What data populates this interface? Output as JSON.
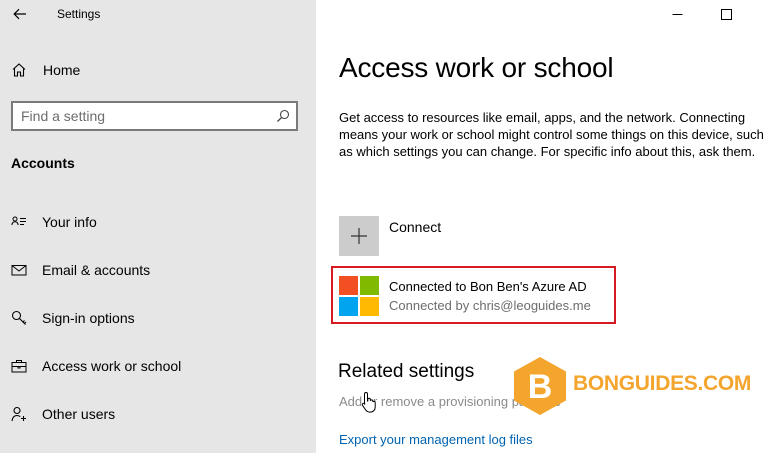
{
  "window": {
    "title": "Settings",
    "back_icon": "arrow-left-icon",
    "minimize_icon": "minimize-icon",
    "maximize_icon": "maximize-icon"
  },
  "sidebar": {
    "home_label": "Home",
    "search_placeholder": "Find a setting",
    "section_title": "Accounts",
    "items": [
      {
        "label": "Your info",
        "icon": "person-card-icon"
      },
      {
        "label": "Email & accounts",
        "icon": "mail-icon"
      },
      {
        "label": "Sign-in options",
        "icon": "key-icon"
      },
      {
        "label": "Access work or school",
        "icon": "briefcase-icon"
      },
      {
        "label": "Other users",
        "icon": "person-add-icon"
      }
    ]
  },
  "main": {
    "title": "Access work or school",
    "description": "Get access to resources like email, apps, and the network. Connecting means your work or school might control some things on this device, such as which settings you can change. For specific info about this, ask them.",
    "connect_label": "Connect",
    "account": {
      "name": "Connected to Bon Ben's Azure AD",
      "connected_by": "Connected by chris@leoguides.me",
      "logo_colors": [
        "#f25022",
        "#7fba00",
        "#00a4ef",
        "#ffb900"
      ]
    },
    "related_title": "Related settings",
    "related_links": [
      "Add or remove a provisioning package",
      "Export your management log files"
    ]
  },
  "watermark": {
    "letter": "B",
    "text": "BONGUIDES.COM",
    "color": "#f4a52e"
  }
}
